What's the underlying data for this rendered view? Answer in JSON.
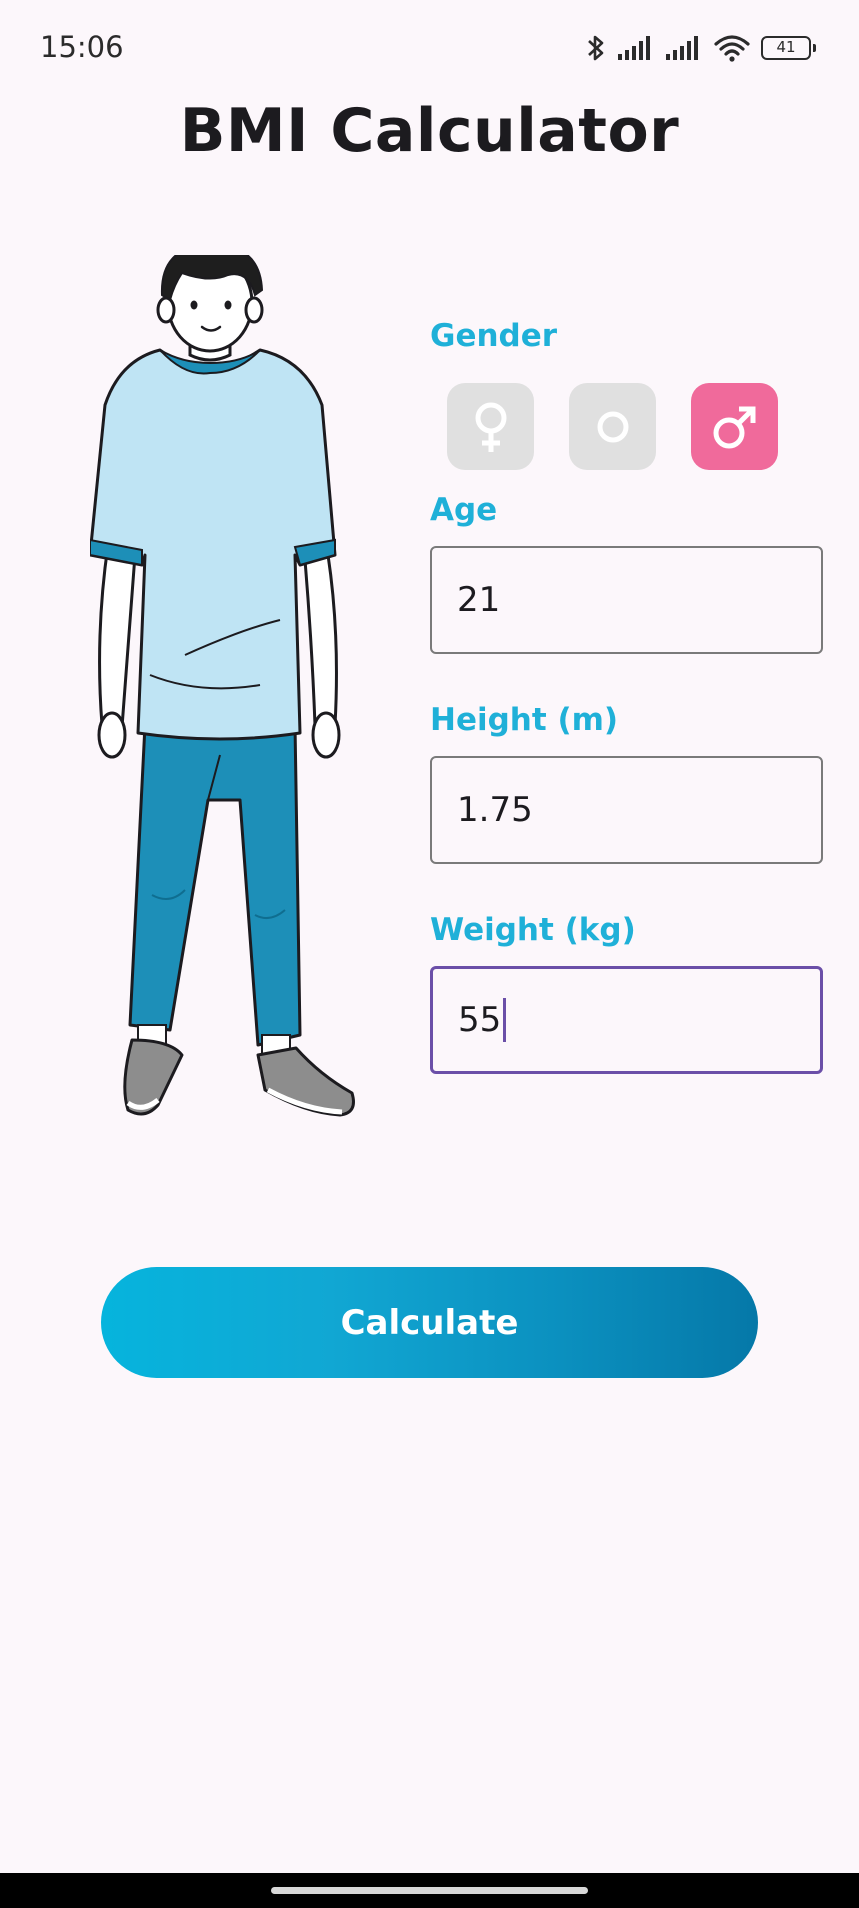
{
  "status_bar": {
    "time": "15:06",
    "battery_level": "41",
    "icons": [
      "bluetooth-icon",
      "signal-icon",
      "signal-icon",
      "wifi-icon",
      "battery-icon"
    ]
  },
  "header": {
    "title": "BMI Calculator"
  },
  "form": {
    "gender": {
      "label": "Gender",
      "options": [
        {
          "icon": "female-icon",
          "selected": false
        },
        {
          "icon": "neutral-icon",
          "selected": false
        },
        {
          "icon": "male-icon",
          "selected": true
        }
      ]
    },
    "age": {
      "label": "Age",
      "value": "21"
    },
    "height": {
      "label": "Height (m)",
      "value": "1.75"
    },
    "weight": {
      "label": "Weight (kg)",
      "value": "55"
    }
  },
  "actions": {
    "calculate_label": "Calculate"
  },
  "colors": {
    "accent": "#1fb0d8",
    "selected_gender": "#f06a9b",
    "unselected_gender": "#e0e0e0",
    "focus_border": "#6b4fa8",
    "button_gradient_start": "#06b4dd",
    "button_gradient_end": "#0578a8",
    "background": "#fcf7fb"
  }
}
